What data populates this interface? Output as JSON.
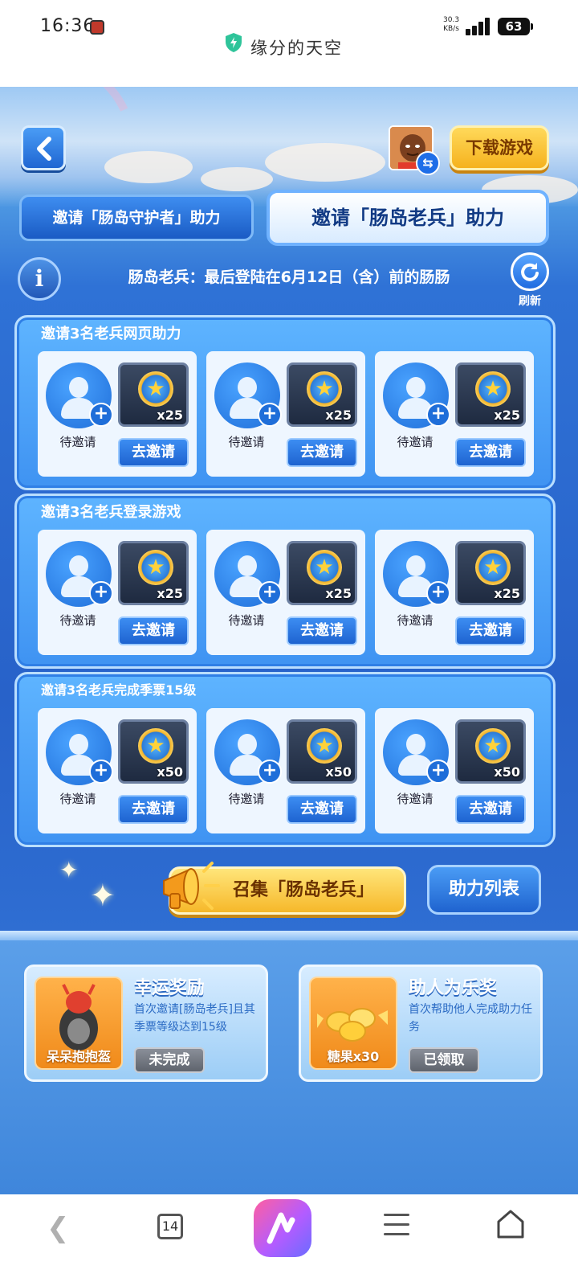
{
  "status_bar": {
    "time": "16:36",
    "net_speed_value": "30.3",
    "net_speed_unit": "KB/s",
    "battery": "63"
  },
  "browser": {
    "page_title": "缘分的天空",
    "tab_count": "14"
  },
  "header": {
    "download_label": "下载游戏"
  },
  "tabs": [
    {
      "label": "邀请「肠岛守护者」助力",
      "active": false
    },
    {
      "label": "邀请「肠岛老兵」助力",
      "active": true
    }
  ],
  "notice": {
    "text": "肠岛老兵：最后登陆在6月12日（含）前的肠肠",
    "refresh_label": "刷新"
  },
  "tasks": [
    {
      "title": "邀请3名老兵网页助力",
      "slots": [
        {
          "status": "待邀请",
          "reward_qty": "x25",
          "button": "去邀请"
        },
        {
          "status": "待邀请",
          "reward_qty": "x25",
          "button": "去邀请"
        },
        {
          "status": "待邀请",
          "reward_qty": "x25",
          "button": "去邀请"
        }
      ]
    },
    {
      "title": "邀请3名老兵登录游戏",
      "slots": [
        {
          "status": "待邀请",
          "reward_qty": "x25",
          "button": "去邀请"
        },
        {
          "status": "待邀请",
          "reward_qty": "x25",
          "button": "去邀请"
        },
        {
          "status": "待邀请",
          "reward_qty": "x25",
          "button": "去邀请"
        }
      ]
    },
    {
      "title": "邀请3名老兵完成季票15级",
      "slots": [
        {
          "status": "待邀请",
          "reward_qty": "x50",
          "button": "去邀请"
        },
        {
          "status": "待邀请",
          "reward_qty": "x50",
          "button": "去邀请"
        },
        {
          "status": "待邀请",
          "reward_qty": "x50",
          "button": "去邀请"
        }
      ]
    }
  ],
  "actions": {
    "call_label": "召集「肠岛老兵」",
    "list_label": "助力列表"
  },
  "awards": [
    {
      "title": "幸运奖励",
      "desc": "首次邀请[肠岛老兵]且其季票等级达到15级",
      "item_name": "呆呆抱抱盔",
      "button": "未完成"
    },
    {
      "title": "助人为乐奖",
      "desc": "首次帮助他人完成助力任务",
      "item_name": "糖果x30",
      "button": "已领取"
    }
  ],
  "colors": {
    "primary_blue": "#2862c9",
    "accent_gold": "#f6b82a",
    "disabled_gray": "#6f747d"
  }
}
